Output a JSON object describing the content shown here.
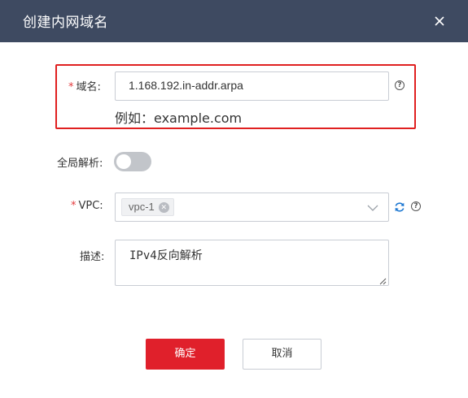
{
  "dialog": {
    "title": "创建内网域名",
    "close_icon": "close-icon"
  },
  "form": {
    "domain": {
      "required_mark": "*",
      "label": "域名:",
      "value": "1.168.192.in-addr.arpa",
      "example": "例如：example.com",
      "help_icon": "help-icon"
    },
    "global_resolution": {
      "label": "全局解析:",
      "enabled": false
    },
    "vpc": {
      "required_mark": "*",
      "label": "VPC:",
      "selected_tag": "vpc-1",
      "refresh_icon": "refresh-icon",
      "help_icon": "help-icon"
    },
    "description": {
      "label": "描述:",
      "value": "IPv4反向解析"
    }
  },
  "buttons": {
    "confirm": "确定",
    "cancel": "取消"
  },
  "colors": {
    "header_bg": "#3e4a61",
    "primary": "#e0202b",
    "highlight_border": "#e02020",
    "required": "#e4393c"
  }
}
